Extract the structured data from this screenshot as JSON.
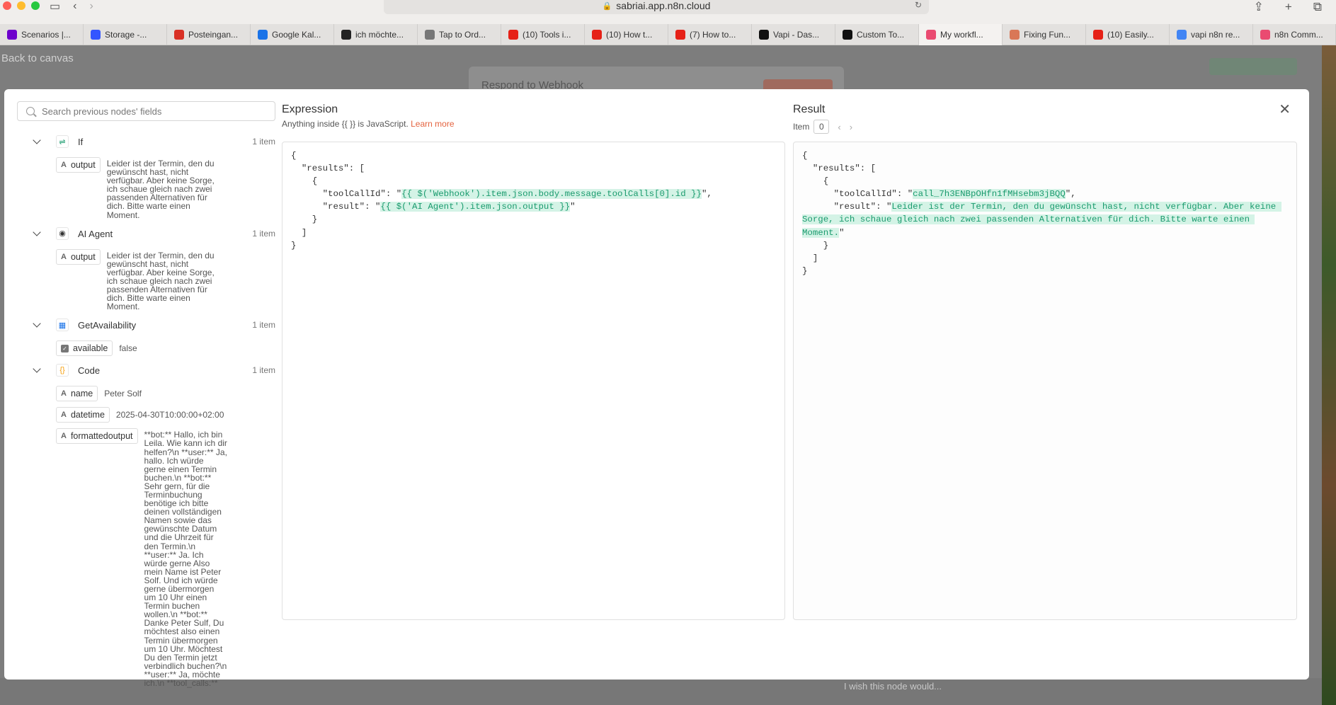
{
  "browser": {
    "url": "sabriai.app.n8n.cloud",
    "tabs": [
      {
        "label": "Scenarios |...",
        "icon": "make-icon",
        "color": "#6d00cc"
      },
      {
        "label": "Storage -...",
        "icon": "storage-icon",
        "color": "#3355ff"
      },
      {
        "label": "Posteingan...",
        "icon": "gmail-icon",
        "color": "#d93025"
      },
      {
        "label": "Google Kal...",
        "icon": "calendar-icon",
        "color": "#1a73e8"
      },
      {
        "label": "ich möchte...",
        "icon": "page-icon",
        "color": "#222222"
      },
      {
        "label": "Tap to Ord...",
        "icon": "number-icon",
        "color": "#777777"
      },
      {
        "label": "(10) Tools i...",
        "icon": "youtube-icon",
        "color": "#e62117"
      },
      {
        "label": "(10) How t...",
        "icon": "youtube-icon",
        "color": "#e62117"
      },
      {
        "label": "(7) How to...",
        "icon": "youtube-icon",
        "color": "#e62117"
      },
      {
        "label": "Vapi - Das...",
        "icon": "vapi-icon",
        "color": "#111111"
      },
      {
        "label": "Custom To...",
        "icon": "vapi-icon",
        "color": "#111111"
      },
      {
        "label": "My workfl...",
        "icon": "n8n-icon",
        "color": "#ea4b71"
      },
      {
        "label": "Fixing Fun...",
        "icon": "claude-icon",
        "color": "#d97757"
      },
      {
        "label": "(10) Easily...",
        "icon": "youtube-icon",
        "color": "#e62117"
      },
      {
        "label": "vapi n8n re...",
        "icon": "google-icon",
        "color": "#4285f4"
      },
      {
        "label": "n8n Comm...",
        "icon": "n8n-icon",
        "color": "#ea4b71"
      }
    ]
  },
  "background": {
    "back_to_canvas": "Back to canvas",
    "node_title": "Respond to Webhook",
    "wish_text": "I wish this node would..."
  },
  "modal": {
    "search_placeholder": "Search previous nodes' fields",
    "nodes": [
      {
        "name": "If",
        "count": "1 item",
        "icon": "if-node-icon",
        "fields": [
          {
            "type": "A",
            "key": "output",
            "value": "Leider ist der Termin, den du gewünscht hast, nicht verfügbar. Aber keine Sorge, ich schaue gleich nach zwei passenden Alternativen für dich. Bitte warte einen Moment."
          }
        ]
      },
      {
        "name": "AI Agent",
        "count": "1 item",
        "icon": "robot-icon",
        "fields": [
          {
            "type": "A",
            "key": "output",
            "value": "Leider ist der Termin, den du gewünscht hast, nicht verfügbar. Aber keine Sorge, ich schaue gleich nach zwei passenden Alternativen für dich. Bitte warte einen Moment."
          }
        ]
      },
      {
        "name": "GetAvailability",
        "count": "1 item",
        "icon": "calendar-node-icon",
        "fields": [
          {
            "type": "checkbox",
            "key": "available",
            "value": "false"
          }
        ]
      },
      {
        "name": "Code",
        "count": "1 item",
        "icon": "code-braces-icon",
        "fields": [
          {
            "type": "A",
            "key": "name",
            "value": "Peter Solf"
          },
          {
            "type": "A",
            "key": "datetime",
            "value": "2025-04-30T10:00:00+02:00"
          },
          {
            "type": "A",
            "key": "formattedoutput",
            "value": "**bot:** Hallo, ich bin Leila. Wie kann ich dir helfen?\\n **user:** Ja, hallo. Ich würde gerne einen Termin buchen.\\n **bot:** Sehr gern, für die Terminbuchung benötige ich bitte deinen vollständigen Namen sowie das gewünschte Datum und die Uhrzeit für den Termin.\\n **user:** Ja. Ich würde gerne Also mein Name ist Peter Solf. Und ich würde gerne übermorgen um 10 Uhr einen Termin buchen wollen.\\n **bot:** Danke Peter Sulf, Du möchtest also einen Termin übermorgen um 10 Uhr. Möchtest Du den Termin jetzt verbindlich buchen?\\n **user:** Ja, möchte ich.\\n **tool_calls:**"
          }
        ]
      }
    ],
    "expression": {
      "title": "Expression",
      "subtitle": "Anything inside {{ }} is JavaScript.",
      "learn_more": "Learn more",
      "lines": [
        {
          "text": "{"
        },
        {
          "text": "  \"results\": ["
        },
        {
          "text": "    {"
        },
        {
          "pre": "      \"toolCallId\": \"",
          "hl": "{{ $('Webhook').item.json.body.message.toolCalls[0].id }}",
          "post": "\","
        },
        {
          "pre": "      \"result\": \"",
          "hl": "{{ $('AI Agent').item.json.output }}",
          "post": "\""
        },
        {
          "text": "    }"
        },
        {
          "text": "  ]"
        },
        {
          "text": "}"
        }
      ]
    },
    "result": {
      "title": "Result",
      "item_label": "Item",
      "item_index": "0",
      "open": "{\n  \"results\": [\n    {",
      "tool_call_pre": "      \"toolCallId\": \"",
      "tool_call_value": "call_7h3ENBpOHfn1fMHsebm3jBQQ",
      "tool_call_post": "\",",
      "result_pre": "      \"result\": \"",
      "result_value": "Leider ist der Termin, den du gewünscht hast, nicht verfügbar. Aber keine Sorge, ich schaue gleich nach zwei passenden Alternativen für dich. Bitte warte einen Moment.",
      "result_post": "\"",
      "close": "    }\n  ]\n}"
    }
  }
}
